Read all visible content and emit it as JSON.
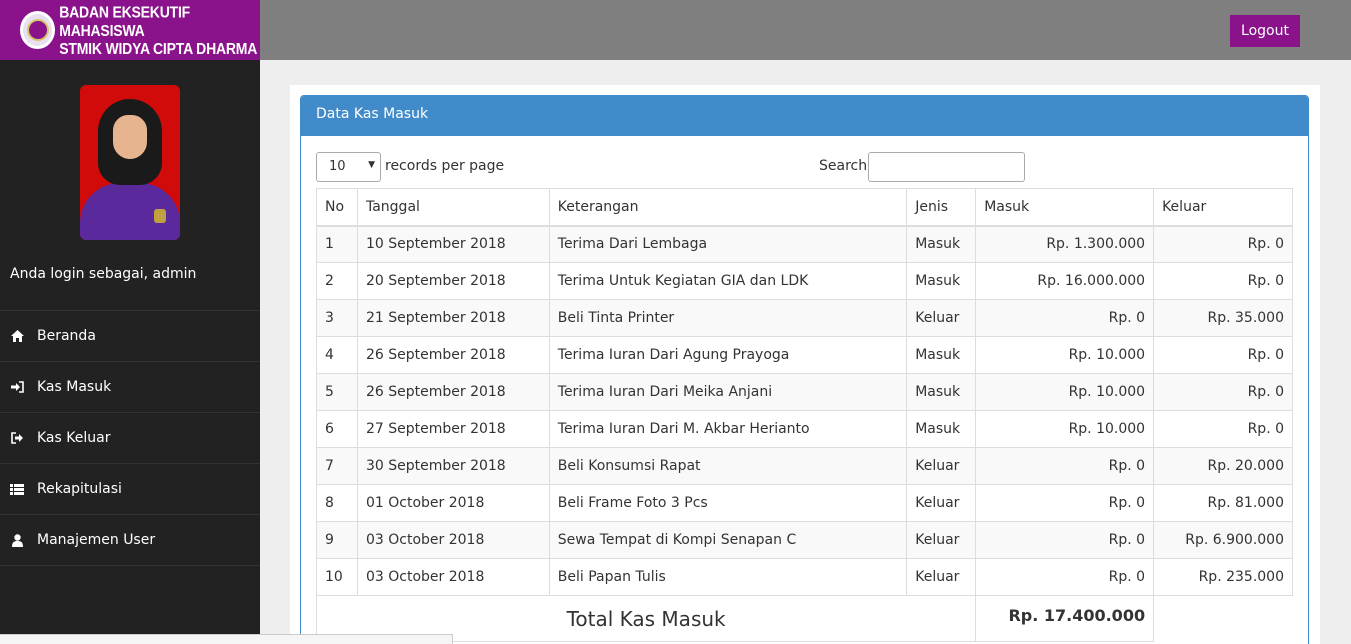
{
  "brand": {
    "line1": "BADAN EKSEKUTIF MAHASISWA",
    "line2": "STMIK WIDYA CIPTA DHARMA"
  },
  "topbar": {
    "logout_label": "Logout"
  },
  "sidebar": {
    "login_text": "Anda login sebagai, admin",
    "items": [
      {
        "label": "Beranda",
        "icon": "home-icon"
      },
      {
        "label": "Kas Masuk",
        "icon": "sign-in-icon"
      },
      {
        "label": "Kas Keluar",
        "icon": "sign-out-icon"
      },
      {
        "label": "Rekapitulasi",
        "icon": "list-icon"
      },
      {
        "label": "Manajemen User",
        "icon": "user-icon"
      }
    ]
  },
  "panel": {
    "title": "Data Kas Masuk",
    "length_value": "10",
    "length_label": "records per page",
    "search_label": "Search:"
  },
  "table": {
    "headers": [
      "No",
      "Tanggal",
      "Keterangan",
      "Jenis",
      "Masuk",
      "Keluar"
    ],
    "rows": [
      [
        "1",
        "10 September 2018",
        "Terima Dari Lembaga",
        "Masuk",
        "Rp. 1.300.000",
        "Rp. 0"
      ],
      [
        "2",
        "20 September 2018",
        "Terima Untuk Kegiatan GIA dan LDK",
        "Masuk",
        "Rp. 16.000.000",
        "Rp. 0"
      ],
      [
        "3",
        "21 September 2018",
        "Beli Tinta Printer",
        "Keluar",
        "Rp. 0",
        "Rp. 35.000"
      ],
      [
        "4",
        "26 September 2018",
        "Terima Iuran Dari Agung Prayoga",
        "Masuk",
        "Rp. 10.000",
        "Rp. 0"
      ],
      [
        "5",
        "26 September 2018",
        "Terima Iuran Dari Meika Anjani",
        "Masuk",
        "Rp. 10.000",
        "Rp. 0"
      ],
      [
        "6",
        "27 September 2018",
        "Terima Iuran Dari M. Akbar Herianto",
        "Masuk",
        "Rp. 10.000",
        "Rp. 0"
      ],
      [
        "7",
        "30 September 2018",
        "Beli Konsumsi Rapat",
        "Keluar",
        "Rp. 0",
        "Rp. 20.000"
      ],
      [
        "8",
        "01 October 2018",
        "Beli Frame Foto 3 Pcs",
        "Keluar",
        "Rp. 0",
        "Rp. 81.000"
      ],
      [
        "9",
        "03 October 2018",
        "Sewa Tempat di Kompi Senapan C",
        "Keluar",
        "Rp. 0",
        "Rp. 6.900.000"
      ],
      [
        "10",
        "03 October 2018",
        "Beli Papan Tulis",
        "Keluar",
        "Rp. 0",
        "Rp. 235.000"
      ]
    ],
    "total_label": "Total Kas Masuk",
    "total_value": "Rp. 17.400.000"
  },
  "colors": {
    "brand": "#8a138b",
    "sidebar": "#222222",
    "topbar": "#7f7f7f",
    "panel_header": "#428bca"
  }
}
